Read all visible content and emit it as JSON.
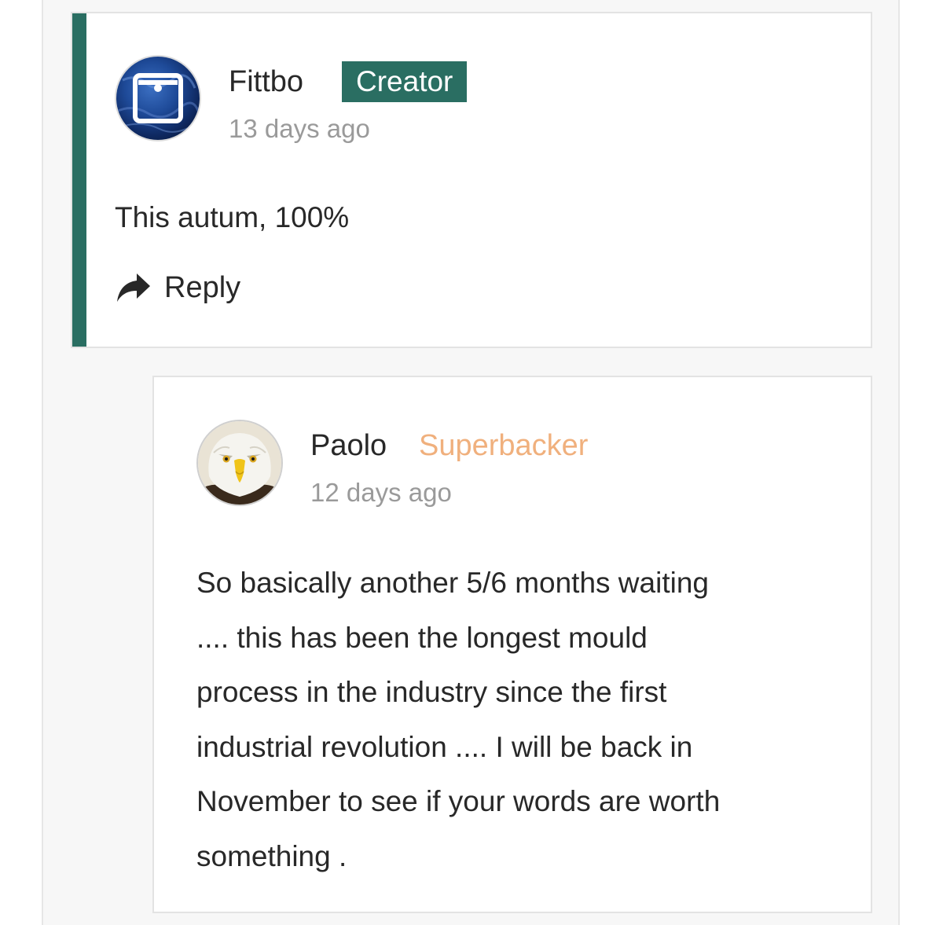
{
  "comments": [
    {
      "author": "Fittbo",
      "badge": "Creator",
      "time": "13 days ago",
      "body": "This autum, 100%",
      "reply_label": "Reply",
      "accent_color": "#2a6e62",
      "avatar_icon": "square-logo-on-earth-icon"
    },
    {
      "author": "Paolo",
      "badge": "Superbacker",
      "time": "12 days ago",
      "body": "So basically another 5/6 months waiting\n.... this has been the longest mould\nprocess in the industry since the first\nindustrial revolution .... I will be back in\nNovember to see if your words are worth\nsomething .",
      "badge_color": "#f0b07d",
      "avatar_icon": "eagle-avatar-icon"
    }
  ]
}
